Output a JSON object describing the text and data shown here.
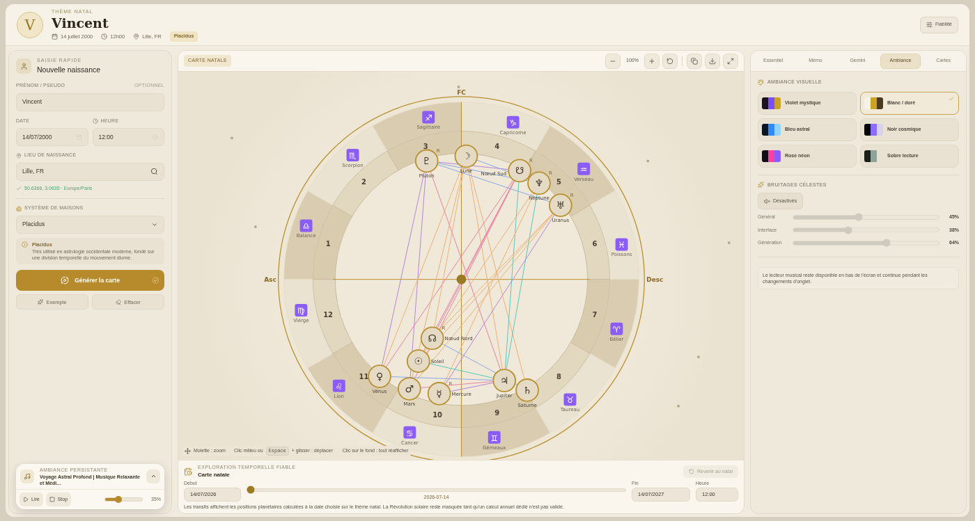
{
  "header": {
    "kicker": "THÈME NATAL",
    "avatar_letter": "V",
    "name": "Vincent",
    "date": "14 juillet 2000",
    "time": "12h00",
    "place": "Lille, FR",
    "system_badge": "Placidus",
    "action_button": "Fiabilité"
  },
  "quick_entry": {
    "kicker": "SAISIE RAPIDE",
    "title": "Nouvelle naissance",
    "name_label": "PRÉNOM / PSEUDO",
    "optional_hint": "OPTIONNEL",
    "name_value": "Vincent",
    "date_label": "DATE",
    "date_value": "14/07/2000",
    "time_label": "HEURE",
    "time_value": "12:00",
    "place_label": "LIEU DE NAISSANCE",
    "place_value": "Lille, FR",
    "geo_status": "50.6366, 3.0635 · Europe/Paris",
    "houses_label": "SYSTÈME DE MAISONS",
    "houses_value": "Placidus",
    "info_title": "Placidus",
    "info_text": "Très utilisé en astrologie occidentale moderne, fondé sur une division temporelle du mouvement diurne.",
    "generate_button": "Générer la carte",
    "secondary_buttons": [
      "Exemple",
      "Effacer"
    ]
  },
  "music_player": {
    "kicker": "AMBIANCE PERSISTANTE",
    "track": "Voyage Astral Profond | Musique Relaxante et Médi…",
    "play_button": "Lire",
    "stop_button": "Stop",
    "volume": {
      "level": 0.35,
      "reading": "35%"
    }
  },
  "chart_panel": {
    "badge": "CARTE NATALE",
    "zoom_reading": "100%",
    "axes": {
      "top": "FC",
      "left": "Asc",
      "right": "Desc"
    },
    "signs": [
      {
        "glyph": "♐",
        "name": "Sagittaire"
      },
      {
        "glyph": "♑",
        "name": "Capricorne"
      },
      {
        "glyph": "♏",
        "name": "Scorpion"
      },
      {
        "glyph": "♒",
        "name": "Verseau"
      },
      {
        "glyph": "♎",
        "name": "Balance"
      },
      {
        "glyph": "♓",
        "name": "Poissons"
      },
      {
        "glyph": "♍",
        "name": "Vierge"
      },
      {
        "glyph": "♈",
        "name": "Bélier"
      },
      {
        "glyph": "♌",
        "name": "Lion"
      },
      {
        "glyph": "♉",
        "name": "Taureau"
      },
      {
        "glyph": "♋",
        "name": "Cancer"
      },
      {
        "glyph": "♊",
        "name": "Gémeaux"
      }
    ],
    "houses": [
      "3",
      "4",
      "2",
      "5",
      "1",
      "6",
      "12",
      "7",
      "11",
      "8",
      "10",
      "9"
    ],
    "planets": [
      {
        "glyph": "♇",
        "name": "Pluton",
        "retrograde_mark": "R"
      },
      {
        "glyph": "☽",
        "name": "Lune"
      },
      {
        "glyph": "☋",
        "name": "Nœud Sud",
        "retrograde_mark": "R"
      },
      {
        "glyph": "♆",
        "name": "Neptune",
        "retrograde_mark": "R"
      },
      {
        "glyph": "♅",
        "name": "Uranus",
        "retrograde_mark": "R"
      },
      {
        "glyph": "☊",
        "name": "Nœud Nord",
        "retrograde_mark": "R"
      },
      {
        "glyph": "☉",
        "name": "Soleil"
      },
      {
        "glyph": "♃",
        "name": "Jupiter"
      },
      {
        "glyph": "♀",
        "name": "Vénus"
      },
      {
        "glyph": "♂",
        "name": "Mars"
      },
      {
        "glyph": "♄",
        "name": "Saturne"
      },
      {
        "glyph": "☿",
        "name": "Mercure",
        "retrograde_mark": "R"
      }
    ],
    "hints": {
      "wheel": "Molette : zoom",
      "pan_prefix": "Clic milieu ou",
      "pan_key": "Espace",
      "pan_suffix": "+ glisser : déplacer",
      "reset": "Clic sur le fond : tout réafficher"
    }
  },
  "timeline": {
    "kicker": "EXPLORATION TEMPORELLE FIABLE",
    "title": "Carte natale",
    "reset_button": {
      "label": "Revenir au natal",
      "disabled": true
    },
    "start": {
      "label": "Début",
      "value": "14/07/2026"
    },
    "slider": {
      "level": 0.01,
      "reading": "2026-07-14"
    },
    "end": {
      "label": "Fin",
      "value": "14/07/2027"
    },
    "time": {
      "label": "Heure",
      "value": "12:00"
    },
    "footnote": "Les transits affichent les positions planétaires calculées à la date choisie sur le thème natal. La Révolution solaire reste masquée tant qu'un calcul annuel dédié n'est pas validé."
  },
  "side_panel": {
    "tabs": [
      {
        "label": "Essentiel",
        "selected": false
      },
      {
        "label": "Mémo",
        "selected": false
      },
      {
        "label": "Gemini",
        "selected": false
      },
      {
        "label": "Ambiance",
        "selected": true
      },
      {
        "label": "Cartes",
        "selected": false
      }
    ],
    "visual_title": "AMBIANCE VISUELLE",
    "themes": [
      {
        "name": "Violet mystique",
        "swatch": [
          {
            "color": "#1a1024"
          },
          {
            "color": "#7c4dff"
          },
          {
            "color": "#c9a227"
          }
        ],
        "selected": false
      },
      {
        "name": "Blanc / doré",
        "swatch": [
          {
            "color": "#f6f2e8"
          },
          {
            "color": "#c9a227"
          },
          {
            "color": "#4a3a22"
          }
        ],
        "selected": true
      },
      {
        "name": "Bleu astral",
        "swatch": [
          {
            "color": "#0a1628"
          },
          {
            "color": "#2e8bff"
          },
          {
            "color": "#8fd3ff"
          }
        ],
        "selected": false
      },
      {
        "name": "Noir cosmique",
        "swatch": [
          {
            "color": "#050505"
          },
          {
            "color": "#8a6cff"
          },
          {
            "color": "#d9d0ee"
          }
        ],
        "selected": false
      },
      {
        "name": "Rose néon",
        "swatch": [
          {
            "color": "#140a18"
          },
          {
            "color": "#ff3ea5"
          },
          {
            "color": "#8a5cff"
          }
        ],
        "selected": false
      },
      {
        "name": "Sobre lecture",
        "swatch": [
          {
            "color": "#1a1f1a"
          },
          {
            "color": "#8fa39a"
          }
        ],
        "selected": false
      }
    ],
    "sound_title": "BRUITAGES CÉLESTES",
    "mute_button": "Désactivés",
    "sound_sliders": [
      {
        "label": "Général",
        "level": 0.45,
        "reading": "45%"
      },
      {
        "label": "Interface",
        "level": 0.38,
        "reading": "38%"
      },
      {
        "label": "Génération",
        "level": 0.64,
        "reading": "64%"
      }
    ],
    "note": "Le lecteur musical reste disponible en bas de l'écran et continue pendant les changements d'onglet."
  }
}
